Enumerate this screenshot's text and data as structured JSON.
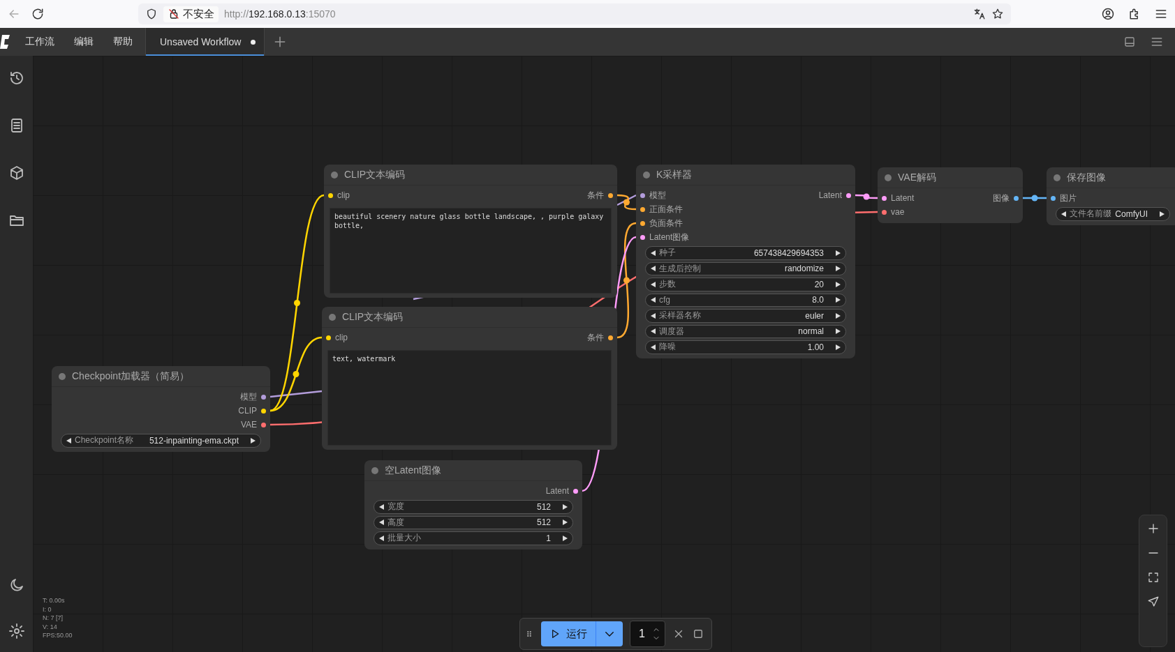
{
  "browser": {
    "security_label": "不安全",
    "url": {
      "scheme": "http://",
      "host": "192.168.0.13",
      "port": ":15070"
    }
  },
  "menu": [
    "工作流",
    "编辑",
    "帮助"
  ],
  "tabs": [
    {
      "label": "Unsaved Workflow",
      "selected": true,
      "modified": true
    }
  ],
  "nodes": [
    {
      "kind": "prompt",
      "title": "CLIP文本编码",
      "inputs": [
        {
          "label": "clip",
          "color": "#ffd500"
        }
      ],
      "outputs": [
        {
          "label": "条件",
          "color": "#ffa931"
        }
      ],
      "text": "beautiful scenery nature glass bottle landscape, , purple galaxy bottle,"
    },
    {
      "kind": "prompt",
      "title": "CLIP文本编码",
      "inputs": [
        {
          "label": "clip",
          "color": "#ffd500"
        }
      ],
      "outputs": [
        {
          "label": "条件",
          "color": "#ffa931"
        }
      ],
      "text": "text, watermark"
    },
    {
      "kind": "widgets",
      "title": "K采样器",
      "inputs": [
        {
          "label": "模型",
          "color": "#b39ddb"
        },
        {
          "label": "正面条件",
          "color": "#ffa931"
        },
        {
          "label": "负面条件",
          "color": "#ffa931"
        },
        {
          "label": "Latent图像",
          "color": "#ff9cf9"
        }
      ],
      "outputs": [
        {
          "label": "Latent",
          "color": "#ff9cf9"
        }
      ],
      "widgets": [
        {
          "label": "种子",
          "value": "657438429694353"
        },
        {
          "label": "生成后控制",
          "value": "randomize"
        },
        {
          "label": "步数",
          "value": "20"
        },
        {
          "label": "cfg",
          "value": "8.0"
        },
        {
          "label": "采样器名称",
          "value": "euler"
        },
        {
          "label": "调度器",
          "value": "normal"
        },
        {
          "label": "降噪",
          "value": "1.00"
        }
      ]
    },
    {
      "kind": "widgets",
      "title": "VAE解码",
      "inputs": [
        {
          "label": "Latent",
          "color": "#ff9cf9"
        },
        {
          "label": "vae",
          "color": "#ff6e6e"
        }
      ],
      "outputs": [
        {
          "label": "图像",
          "color": "#64b5f6"
        }
      ]
    },
    {
      "kind": "widgets",
      "title": "保存图像",
      "inputs": [
        {
          "label": "图片",
          "color": "#64b5f6"
        }
      ],
      "widgets": [
        {
          "label": "文件名前缀",
          "value": "ComfyUI"
        }
      ]
    },
    {
      "kind": "widgets",
      "title": "Checkpoint加载器（简易）",
      "outputs": [
        {
          "label": "模型",
          "color": "#b39ddb"
        },
        {
          "label": "CLIP",
          "color": "#ffd500"
        },
        {
          "label": "VAE",
          "color": "#ff6e6e"
        }
      ],
      "widgets": [
        {
          "label": "Checkpoint名称",
          "value": "512-inpainting-ema.ckpt"
        }
      ]
    },
    {
      "kind": "widgets",
      "title": "空Latent图像",
      "outputs": [
        {
          "label": "Latent",
          "color": "#ff9cf9"
        }
      ],
      "widgets": [
        {
          "label": "宽度",
          "value": "512"
        },
        {
          "label": "高度",
          "value": "512"
        },
        {
          "label": "批量大小",
          "value": "1"
        }
      ]
    }
  ],
  "stats": [
    "T: 0.00s",
    "I: 0",
    "N: 7 [7]",
    "V: 14",
    "FPS:50.00"
  ],
  "run_bar": {
    "run_label": "运行",
    "count": "1"
  }
}
